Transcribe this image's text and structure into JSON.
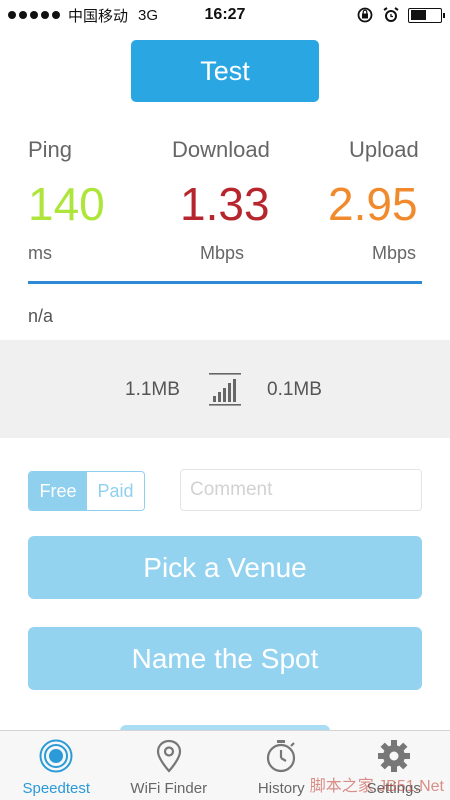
{
  "status_bar": {
    "carrier": "中国移动",
    "network": "3G",
    "time": "16:27",
    "signal_dots": 5
  },
  "test_button": {
    "label": "Test"
  },
  "metrics": {
    "ping": {
      "label": "Ping",
      "value": "140",
      "unit": "ms",
      "color": "#aee53a"
    },
    "download": {
      "label": "Download",
      "value": "1.33",
      "unit": "Mbps",
      "color": "#b7262d"
    },
    "upload": {
      "label": "Upload",
      "value": "2.95",
      "unit": "Mbps",
      "color": "#f08a2c"
    }
  },
  "location_text": "n/a",
  "data_usage": {
    "download": "1.1MB",
    "upload": "0.1MB"
  },
  "plan_toggle": {
    "free_label": "Free",
    "paid_label": "Paid",
    "selected": "Free"
  },
  "comment": {
    "placeholder": "Comment",
    "value": ""
  },
  "buttons": {
    "pick_venue": "Pick a Venue",
    "name_spot": "Name the Spot"
  },
  "tabs": [
    {
      "label": "Speedtest",
      "icon": "speedtest-icon",
      "active": true
    },
    {
      "label": "WiFi Finder",
      "icon": "location-pin-icon",
      "active": false
    },
    {
      "label": "History",
      "icon": "stopwatch-icon",
      "active": false
    },
    {
      "label": "Settings",
      "icon": "gear-icon",
      "active": false
    }
  ],
  "watermark": "脚本之家 JB51.Net",
  "colors": {
    "accent": "#2aa7e3",
    "light_accent": "#94d3f0",
    "divider": "#2f8ad6"
  }
}
